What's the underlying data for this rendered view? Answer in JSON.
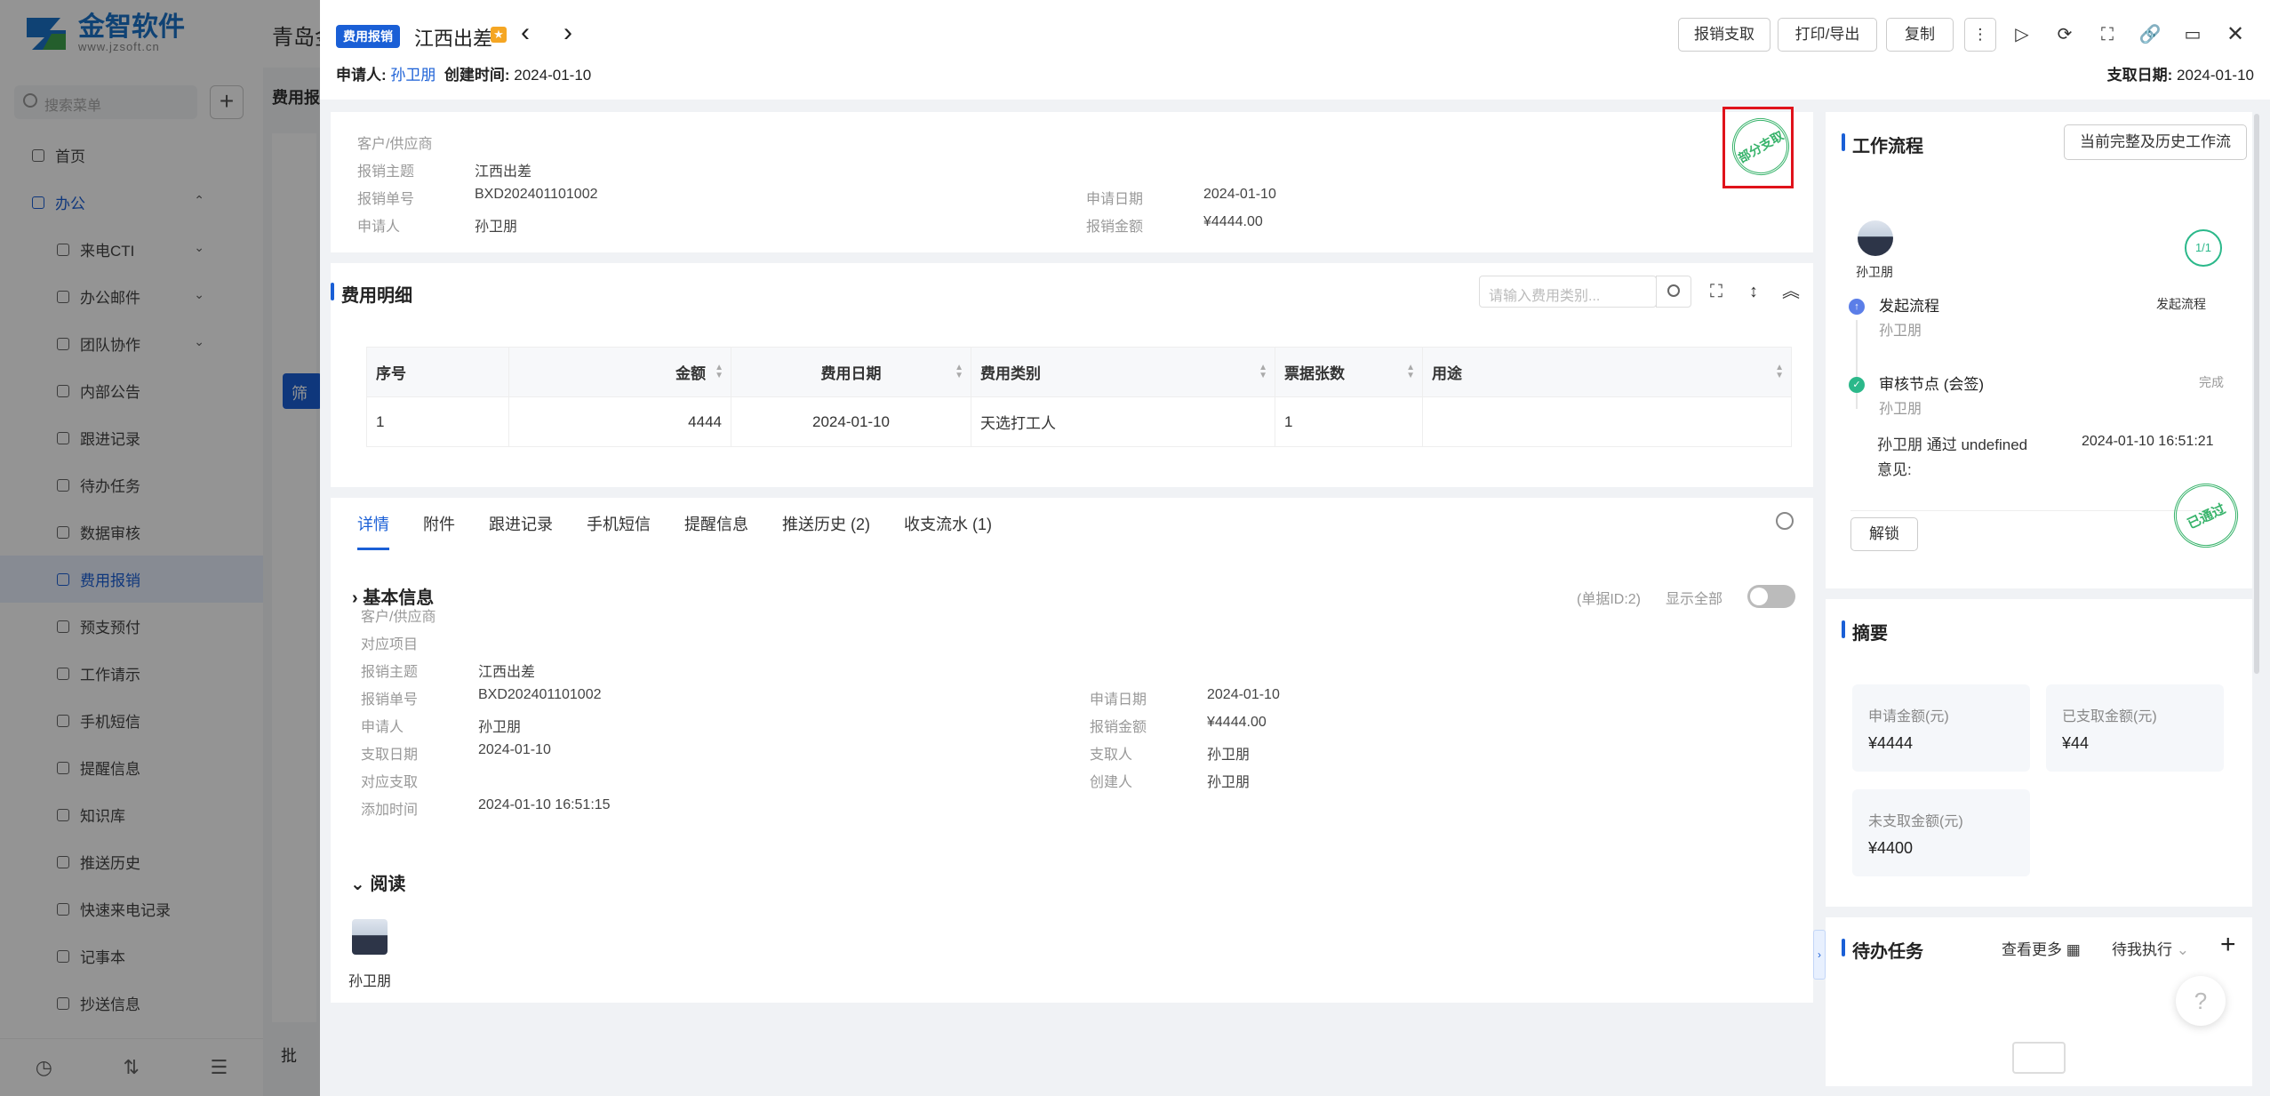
{
  "app": {
    "logo_name": "金智软件",
    "logo_url": "www.jzsoft.cn",
    "search_placeholder": "搜索菜单",
    "menu": [
      {
        "label": "首页",
        "level": 0
      },
      {
        "label": "办公",
        "level": 0,
        "state": "open",
        "chev": "⌃"
      },
      {
        "label": "来电CTI",
        "level": 1,
        "chev": "⌄"
      },
      {
        "label": "办公邮件",
        "level": 1,
        "chev": "⌄"
      },
      {
        "label": "团队协作",
        "level": 1,
        "chev": "⌄"
      },
      {
        "label": "内部公告",
        "level": 1
      },
      {
        "label": "跟进记录",
        "level": 1
      },
      {
        "label": "待办任务",
        "level": 1
      },
      {
        "label": "数据审核",
        "level": 1
      },
      {
        "label": "费用报销",
        "level": 1,
        "state": "active"
      },
      {
        "label": "预支预付",
        "level": 1
      },
      {
        "label": "工作请示",
        "level": 1
      },
      {
        "label": "手机短信",
        "level": 1
      },
      {
        "label": "提醒信息",
        "level": 1
      },
      {
        "label": "知识库",
        "level": 1
      },
      {
        "label": "推送历史",
        "level": 1
      },
      {
        "label": "快速来电记录",
        "level": 1
      },
      {
        "label": "记事本",
        "level": 1
      },
      {
        "label": "抄送信息",
        "level": 1
      }
    ],
    "bg_title": "青岛金",
    "bg_subtitle": "费用报",
    "bg_filter_btn": "筛",
    "bg_bottom_btn": "批"
  },
  "drawer": {
    "type_tag": "费用报销",
    "title": "江西出差",
    "meta": {
      "applicant_label": "申请人:",
      "applicant": "孙卫朋",
      "created_label": "创建时间:",
      "created": "2024-01-10",
      "pay_date_label": "支取日期:",
      "pay_date": "2024-01-10"
    },
    "buttons": {
      "pay": "报销支取",
      "print": "打印/导出",
      "copy": "复制"
    },
    "stamp_text": "部分支取",
    "summary_fields": [
      {
        "label": "客户/供应商",
        "value": ""
      },
      {
        "label": "报销主题",
        "value": "江西出差"
      },
      {
        "label": "报销单号",
        "value": "BXD202401101002"
      },
      {
        "label": "申请日期",
        "value": "2024-01-10"
      },
      {
        "label": "申请人",
        "value": "孙卫朋"
      },
      {
        "label": "报销金额",
        "value": "¥4444.00"
      }
    ],
    "expense": {
      "title": "费用明细",
      "search_placeholder": "请输入费用类别...",
      "headers": [
        "序号",
        "金额",
        "费用日期",
        "费用类别",
        "票据张数",
        "用途"
      ],
      "rows": [
        [
          "1",
          "4444",
          "2024-01-10",
          "天选打工人",
          "1",
          ""
        ]
      ]
    },
    "tabs": [
      "详情",
      "附件",
      "跟进记录",
      "手机短信",
      "提醒信息",
      "推送历史 (2)",
      "收支流水 (1)"
    ],
    "basic": {
      "title": "基本信息",
      "doc_id": "(单据ID:2)",
      "show_all": "显示全部",
      "left": [
        {
          "label": "客户/供应商",
          "value": ""
        },
        {
          "label": "对应项目",
          "value": ""
        },
        {
          "label": "报销主题",
          "value": "江西出差"
        },
        {
          "label": "报销单号",
          "value": "BXD202401101002"
        },
        {
          "label": "申请人",
          "value": "孙卫朋"
        },
        {
          "label": "支取日期",
          "value": "2024-01-10"
        },
        {
          "label": "对应支取",
          "value": ""
        },
        {
          "label": "添加时间",
          "value": "2024-01-10 16:51:15"
        }
      ],
      "right": [
        {
          "label": "申请日期",
          "value": "2024-01-10"
        },
        {
          "label": "报销金额",
          "value": "¥4444.00"
        },
        {
          "label": "支取人",
          "value": "孙卫朋"
        },
        {
          "label": "创建人",
          "value": "孙卫朋"
        }
      ]
    },
    "read": {
      "title": "阅读",
      "user": "孙卫朋"
    }
  },
  "workflow": {
    "title": "工作流程",
    "history_btn": "当前完整及历史工作流",
    "user": "孙卫朋",
    "progress": "1/1",
    "steps": [
      {
        "name": "发起流程",
        "person": "孙卫朋",
        "status": "发起流程"
      },
      {
        "name": "审核节点 (会签)",
        "person": "孙卫朋",
        "status": "完成"
      }
    ],
    "comment": "孙卫朋 通过 undefined",
    "comment_time": "2024-01-10 16:51:21",
    "opinion_label": "意见:",
    "unlock_btn": "解锁",
    "stamp_text": "已通过"
  },
  "summary": {
    "title": "摘要",
    "boxes": [
      {
        "label": "申请金额(元)",
        "value": "¥4444"
      },
      {
        "label": "已支取金额(元)",
        "value": "¥44"
      },
      {
        "label": "未支取金额(元)",
        "value": "¥4400"
      }
    ]
  },
  "todo": {
    "title": "待办任务",
    "more": "查看更多",
    "filter": "待我执行"
  }
}
